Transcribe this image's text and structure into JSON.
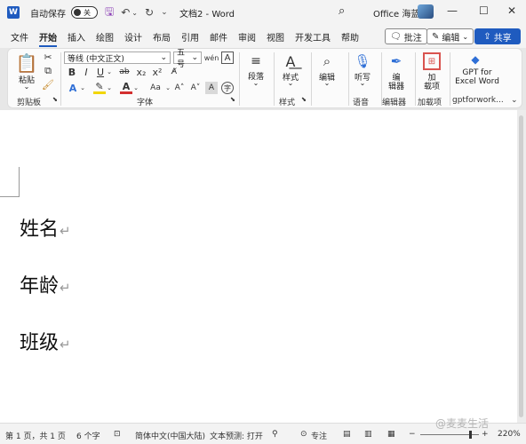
{
  "titlebar": {
    "autosave_label": "自动保存",
    "autosave_state": "关",
    "doc_title": "文档2 - Word",
    "account_name": "Office 海蓝"
  },
  "tabs": [
    "文件",
    "开始",
    "插入",
    "绘图",
    "设计",
    "布局",
    "引用",
    "邮件",
    "审阅",
    "视图",
    "开发工具",
    "帮助"
  ],
  "actions": {
    "comment": "批注",
    "edit": "编辑",
    "share": "共享"
  },
  "ribbon": {
    "clipboard": {
      "paste": "粘贴",
      "label": "剪贴板"
    },
    "font": {
      "name": "等线 (中文正文)",
      "size": "五号",
      "label": "字体",
      "buttons": [
        "B",
        "I",
        "U",
        "ab",
        "x₂",
        "x²"
      ]
    },
    "paragraph": {
      "label": "段落"
    },
    "styles": {
      "label": "样式",
      "button": "样式"
    },
    "editing": {
      "button": "编辑"
    },
    "voice": {
      "button": "听写",
      "label": "语音"
    },
    "editor": {
      "button": "编\n辑器",
      "button_l1": "编",
      "button_l2": "辑器",
      "label": "编辑器"
    },
    "addins": {
      "button_l1": "加",
      "button_l2": "载项",
      "label": "加载项"
    },
    "gpt": {
      "line1": "GPT for",
      "line2": "Excel Word",
      "label": "gptforwork..."
    }
  },
  "document": {
    "lines": [
      "姓名",
      "年龄",
      "班级"
    ],
    "para_mark": "↵"
  },
  "status": {
    "page": "第 1 页，共 1 页",
    "words": "6 个字",
    "language": "简体中文(中国大陆)",
    "prediction": "文本预测: 打开",
    "focus": "专注",
    "zoom": "220%"
  },
  "watermark": "@麦麦生活",
  "colors": {
    "accent": "#1f5bbf",
    "highlight": "#f2d600",
    "font_red": "#d32f2f"
  }
}
